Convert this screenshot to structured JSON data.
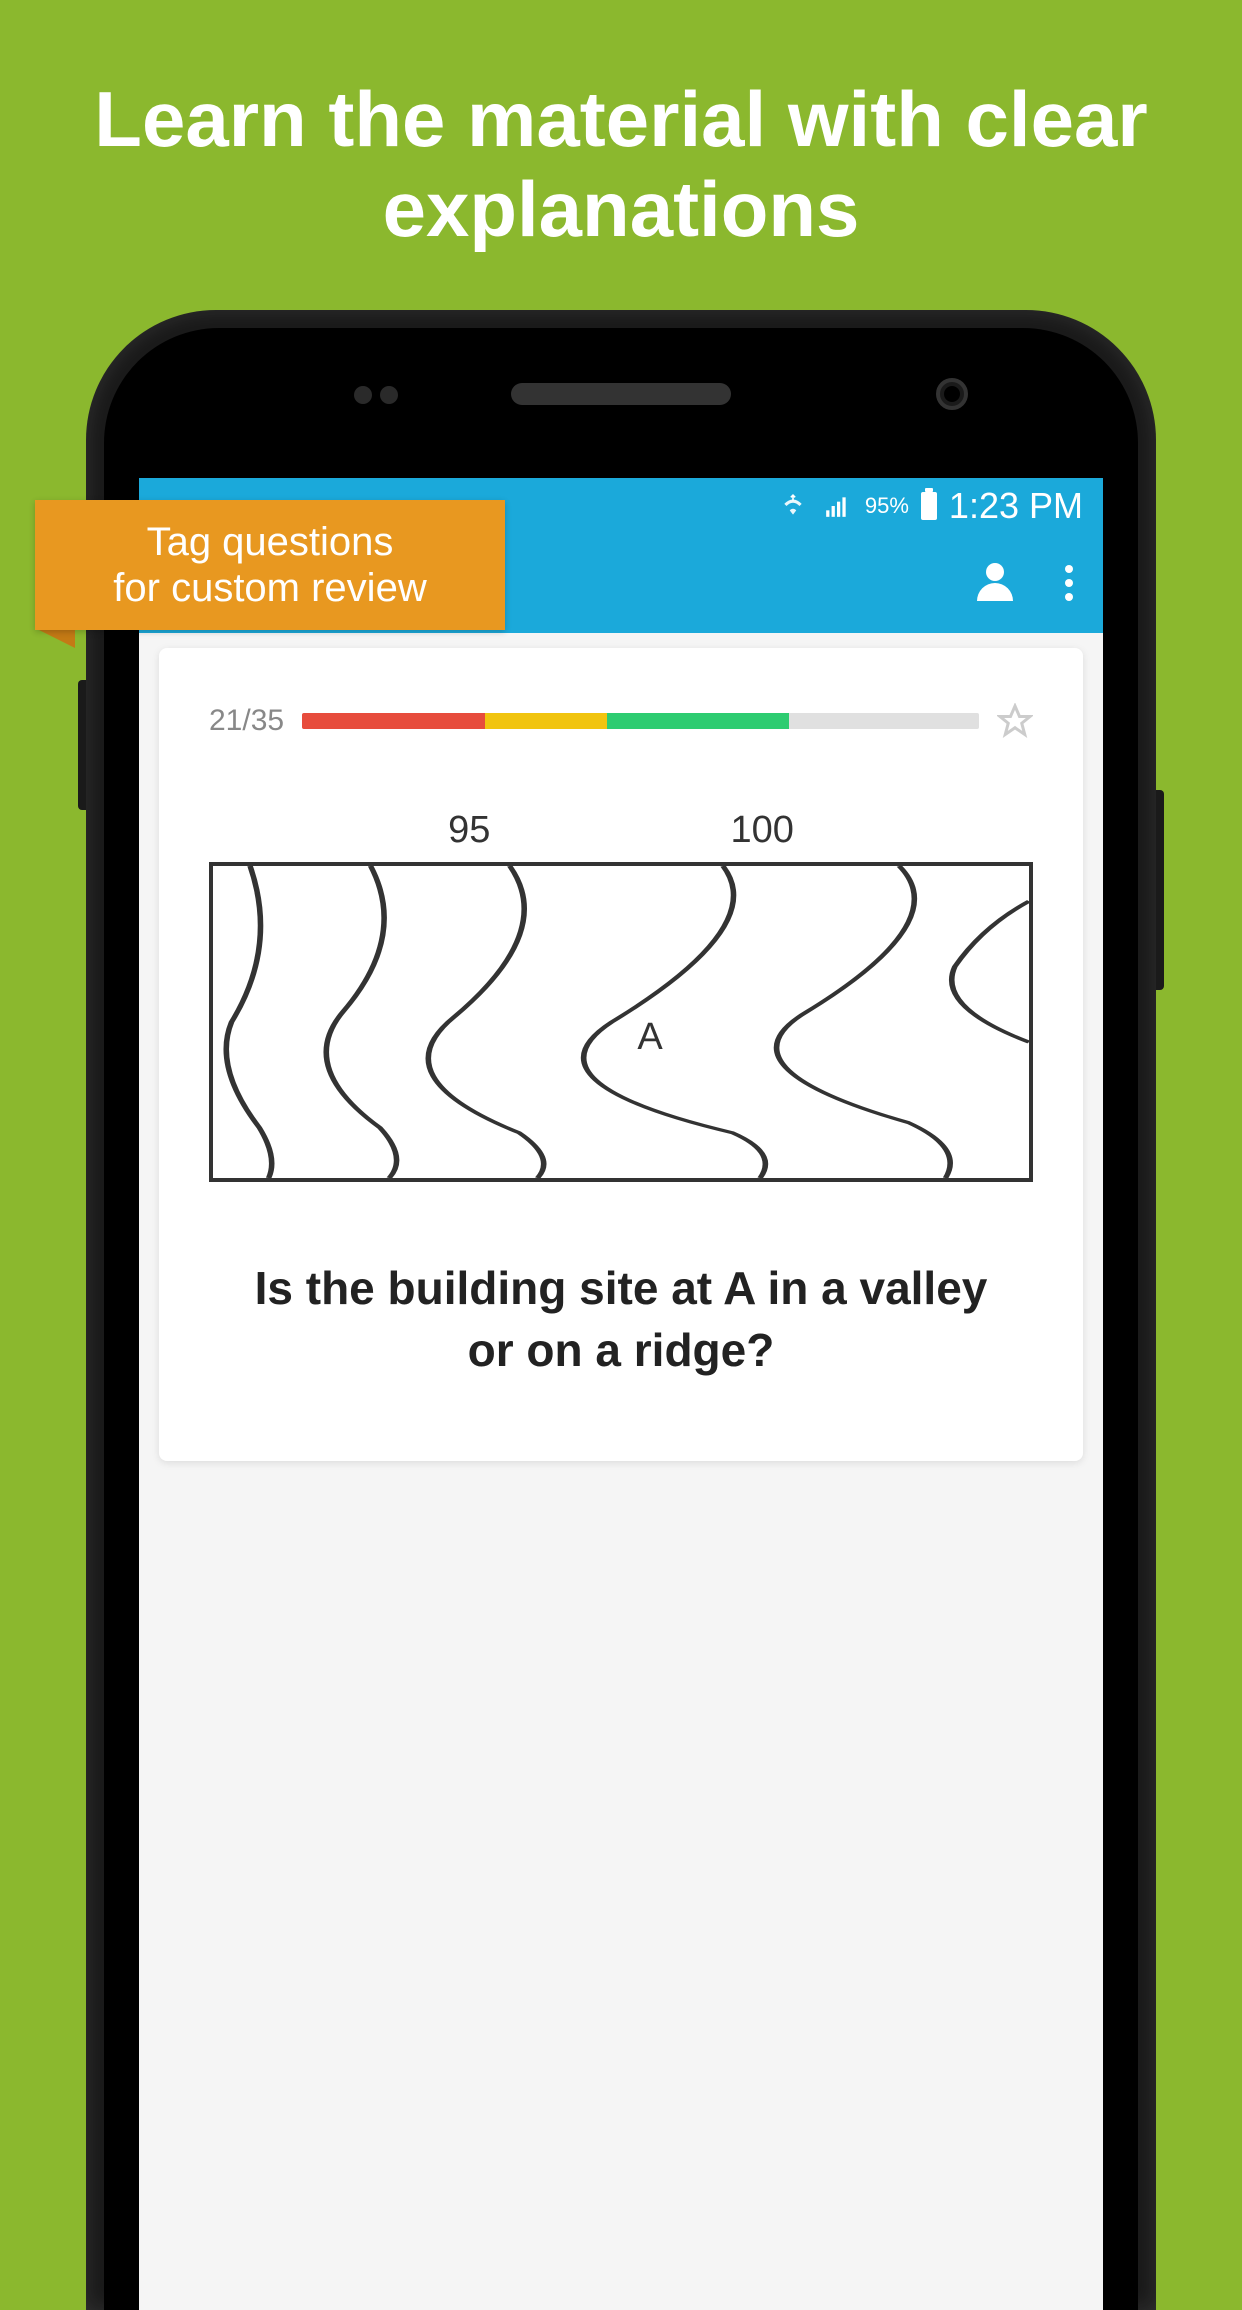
{
  "headline": "Learn the material with clear explanations",
  "callout": {
    "line1": "Tag questions",
    "line2": "for custom review"
  },
  "status_bar": {
    "battery_percent": "95%",
    "time": "1:23 PM"
  },
  "card": {
    "progress_counter": "21/35",
    "diagram_labels": {
      "left": "95",
      "right": "100"
    },
    "marker": "A",
    "question": "Is the building site at A in a valley or on a ridge?"
  },
  "colors": {
    "background": "#8BB82E",
    "callout": "#E89820",
    "appbar": "#1BA9DA"
  }
}
